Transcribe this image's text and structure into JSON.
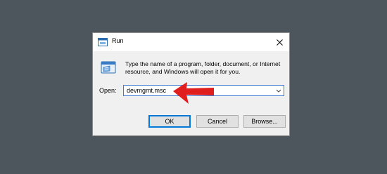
{
  "dialog": {
    "title": "Run",
    "description": "Type the name of a program, folder, document, or Internet resource, and Windows will open it for you.",
    "open_label": "Open:",
    "open_value": "devmgmt.msc",
    "buttons": {
      "ok": "OK",
      "cancel": "Cancel",
      "browse": "Browse..."
    }
  },
  "icons": {
    "title": "run-icon",
    "dialog": "run-icon",
    "close": "close-icon",
    "dropdown": "chevron-down-icon",
    "annotation": "red-arrow-icon"
  },
  "colors": {
    "background": "#4c565c",
    "accent": "#0078d7",
    "arrow": "#e01e1e"
  }
}
